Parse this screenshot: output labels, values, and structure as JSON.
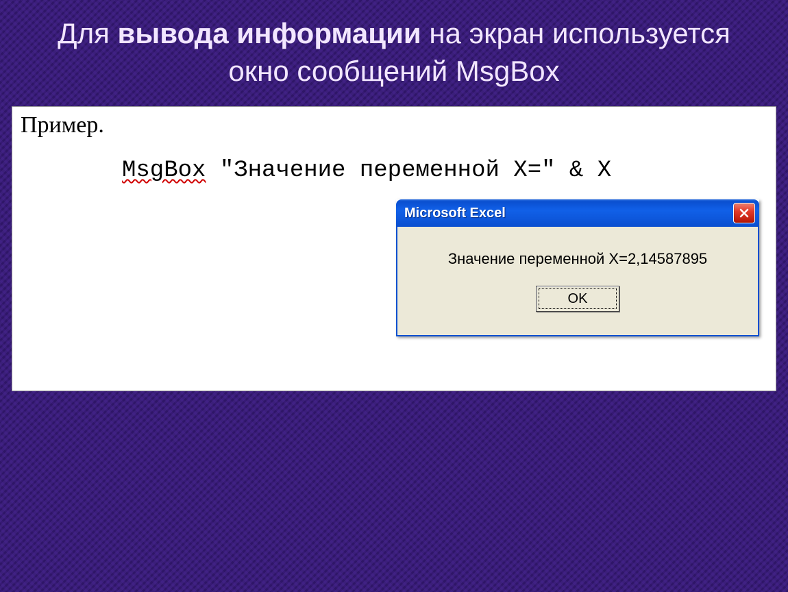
{
  "title": {
    "pre": "Для ",
    "bold": "вывода информации",
    "post": " на экран используется окно сообщений MsgBox"
  },
  "panel": {
    "example_label": "Пример.",
    "code_keyword": "MsgBox",
    "code_rest": " \"Значение переменной X=\" & X"
  },
  "dialog": {
    "title": "Microsoft Excel",
    "message": "Значение переменной X=2,14587895",
    "ok_label": "OK"
  }
}
